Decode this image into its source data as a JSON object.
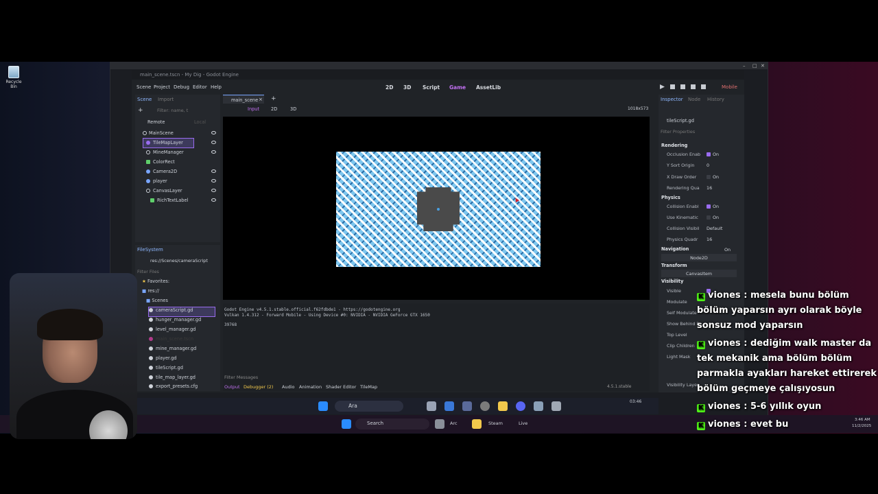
{
  "desktop": {
    "recycle_bin": "Recycle Bin"
  },
  "godot": {
    "title": "main_scene.tscn - My Dig - Godot Engine",
    "menus": [
      "Scene",
      "Project",
      "Debug",
      "Editor",
      "Help"
    ],
    "workspaces": [
      "2D",
      "3D",
      "Script",
      "Game",
      "AssetLib"
    ],
    "active_workspace": "Game",
    "renderer": "Mobile",
    "scene_dock": {
      "tabs": [
        "Scene",
        "Import"
      ],
      "filter_placeholder": "Filter: name, t",
      "remote_label": "Remote",
      "local_label": "Local",
      "nodes": [
        "MainScene",
        "TileMapLayer",
        "MineManager",
        "ColorRect",
        "Camera2D",
        "player",
        "CanvasLayer",
        "RichTextLabel"
      ]
    },
    "filesystem": {
      "title": "FileSystem",
      "path": "res://Scenes/cameraScript",
      "filter_placeholder": "Filter Files",
      "favorites": "Favorites:",
      "root": "res://",
      "folder": "Scenes",
      "files": [
        "cameraScript.gd",
        "hunger_manager.gd",
        "level_manager.gd",
        "main_scene.tscn",
        "mine_manager.gd",
        "player.gd",
        "tileScript.gd",
        "tile_map_layer.gd",
        "export_presets.cfg"
      ]
    },
    "editor_tab": "main_scene",
    "viewport_toolbar": [
      "Input",
      "2D",
      "3D"
    ],
    "viewport_size": "1018x573",
    "output": {
      "lines": [
        "Godot Engine v4.5.1.stable.official.f62fdbde1 - https://godotengine.org",
        "Vulkan 1.4.312 - Forward Mobile - Using Device #0: NVIDIA - NVIDIA GeForce GTX 1650",
        "39768"
      ],
      "filter_placeholder": "Filter Messages",
      "bottom_tabs": [
        "Output",
        "Debugger (2)",
        "Audio",
        "Animation",
        "Shader Editor",
        "TileMap"
      ],
      "version": "4.5.1.stable"
    },
    "inspector": {
      "tabs": [
        "Inspector",
        "Node",
        "History"
      ],
      "resource": "tileScript.gd",
      "filter_placeholder": "Filter Properties",
      "sections": {
        "rendering": "Rendering",
        "physics": "Physics",
        "navigation": "Navigation",
        "transform": "Transform",
        "visibility": "Visibility"
      },
      "rows": {
        "occlusion": "Occlusion Enab",
        "occlusion_val": "On",
        "ysort": "Y Sort Origin",
        "ysort_val": "0",
        "xdraw": "X Draw Order",
        "xdraw_val": "On",
        "render_q": "Rendering Qua",
        "render_q_val": "16",
        "collision_en": "Collision Enabl",
        "collision_en_val": "On",
        "kinematic": "Use Kinematic",
        "kinematic_val": "On",
        "collision_vis": "Collision Visibil",
        "collision_vis_val": "Default",
        "phys_quad": "Physics Quadr",
        "phys_quad_val": "16",
        "nav_val": "On",
        "node2d": "Node2D",
        "canvasitem": "CanvasItem",
        "visible": "Visible",
        "modulate": "Modulate",
        "self_modulate": "Self Modulate",
        "show_behind": "Show Behind P",
        "top_level": "Top Level",
        "clip_children": "Clip Children",
        "light_mask": "Light Mask",
        "visibility_layer": "Visibility Layer"
      }
    }
  },
  "remote_taskbar": {
    "search": "Ara",
    "time": "03:46"
  },
  "local_taskbar": {
    "search": "Search",
    "apps": [
      "Arc",
      "Steam",
      "Live"
    ],
    "time": "3:46 AM",
    "date": "11/2/2025"
  },
  "chat": [
    {
      "user": "viones",
      "text": "mesela bunu bölüm bölüm yaparsın ayrı olarak böyle sonsuz mod yaparsın"
    },
    {
      "user": "viones",
      "text": "dediğim walk master da tek mekanik ama bölüm bölüm parmakla ayakları hareket ettirerek bölüm geçmeye çalışıyosun"
    },
    {
      "user": "viones",
      "text": "5-6 yıllık oyun"
    },
    {
      "user": "viones",
      "text": "evet bu"
    }
  ],
  "colors": {
    "accent": "#9a6cf0",
    "kick_green": "#53fc18",
    "tile_blue": "#7ec6ee"
  }
}
